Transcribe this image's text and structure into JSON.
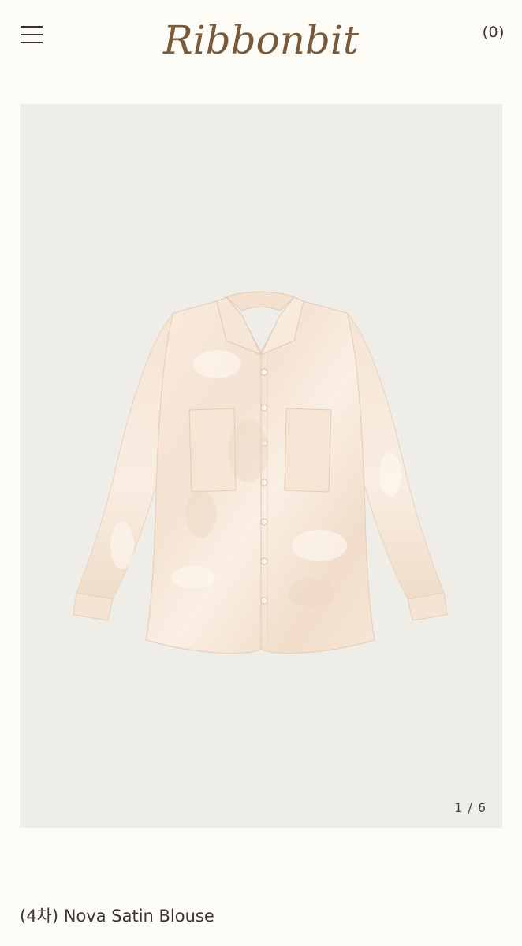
{
  "header": {
    "menu_icon": "hamburger-menu-icon",
    "logo_text": "Ribbonbit",
    "cart_label": "(0)"
  },
  "gallery": {
    "counter": "1 / 6",
    "background_color": "#efede8",
    "garment_color": "#f7e8d8"
  },
  "product": {
    "title": "(4차) Nova Satin Blouse"
  },
  "colors": {
    "page_background": "#fcfbf5",
    "text": "#3a3530",
    "logo": "#7a5a3c"
  }
}
